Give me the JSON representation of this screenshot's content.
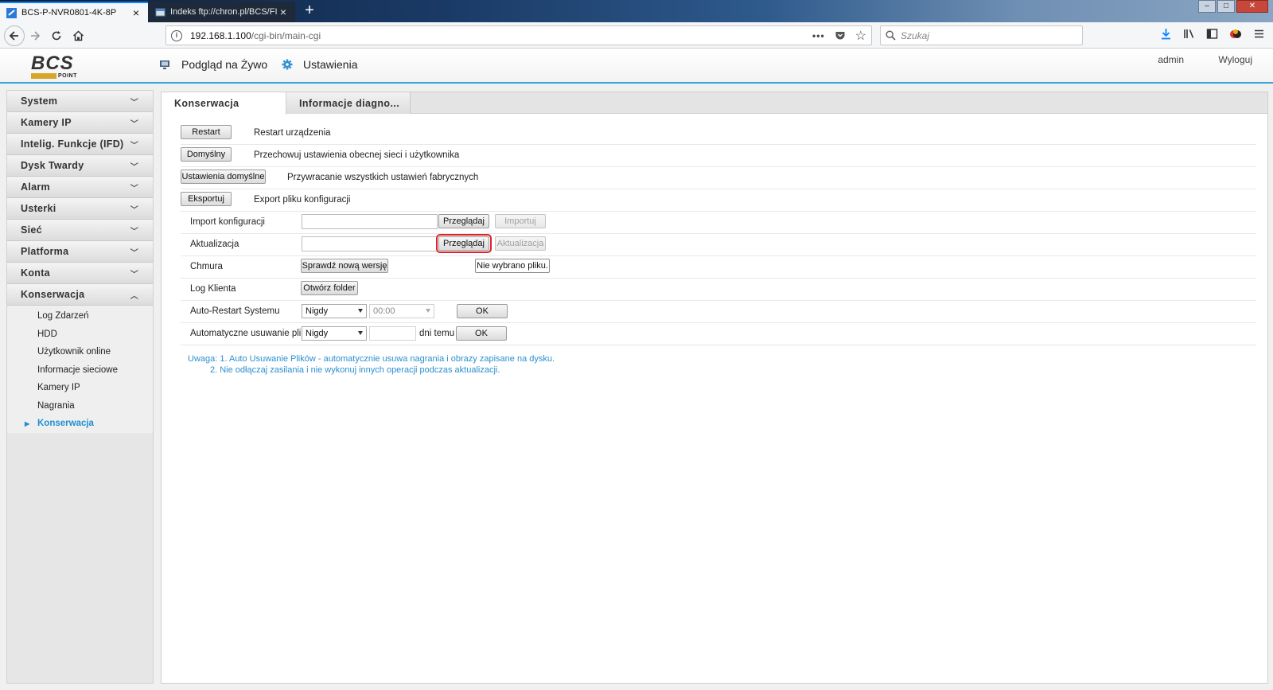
{
  "browser": {
    "tabs": [
      {
        "title": "BCS-P-NVR0801-4K-8P",
        "active": true
      },
      {
        "title": "Indeks ftp://chron.pl/BCS/FIRM",
        "active": false
      }
    ],
    "url_host": "192.168.1.100",
    "url_path": "/cgi-bin/main-cgi",
    "search_placeholder": "Szukaj"
  },
  "header": {
    "logo_text": "BCS",
    "logo_sub": "POINT",
    "nav_live": "Podgląd na Żywo",
    "nav_settings": "Ustawienia",
    "user": "admin",
    "logout": "Wyloguj"
  },
  "sidebar": {
    "items": [
      {
        "label": "System"
      },
      {
        "label": "Kamery IP"
      },
      {
        "label": "Intelig. Funkcje (IFD)"
      },
      {
        "label": "Dysk Twardy"
      },
      {
        "label": "Alarm"
      },
      {
        "label": "Usterki"
      },
      {
        "label": "Sieć"
      },
      {
        "label": "Platforma"
      },
      {
        "label": "Konta"
      },
      {
        "label": "Konserwacja"
      }
    ],
    "subitems": [
      {
        "label": "Log Zdarzeń"
      },
      {
        "label": "HDD"
      },
      {
        "label": "Użytkownik online"
      },
      {
        "label": "Informacje sieciowe"
      },
      {
        "label": "Kamery IP"
      },
      {
        "label": "Nagrania"
      },
      {
        "label": "Konserwacja"
      }
    ]
  },
  "main": {
    "tabs": [
      {
        "label": "Konserwacja"
      },
      {
        "label": "Informacje diagno..."
      }
    ],
    "restart": {
      "button": "Restart",
      "desc": "Restart urządzenia"
    },
    "default": {
      "button": "Domyślny",
      "desc": "Przechowuj ustawienia obecnej sieci i użytkownika"
    },
    "factory": {
      "button": "Ustawienia domyślne",
      "desc": "Przywracanie wszystkich ustawień fabrycznych"
    },
    "export": {
      "button": "Eksportuj",
      "desc": "Export pliku konfiguracji"
    },
    "import": {
      "label": "Import konfiguracji",
      "browse": "Przeglądaj",
      "action": "Importuj"
    },
    "update": {
      "label": "Aktualizacja",
      "browse": "Przeglądaj",
      "action": "Aktualizacja"
    },
    "cloud": {
      "label": "Chmura",
      "check": "Sprawdź nową wersję",
      "file_status": "Nie wybrano pliku."
    },
    "log": {
      "label": "Log Klienta",
      "open": "Otwórz folder"
    },
    "auto_restart": {
      "label": "Auto-Restart Systemu",
      "frequency": "Nigdy",
      "time": "00:00",
      "ok": "OK"
    },
    "auto_delete": {
      "label": "Automatyczne usuwanie pli...",
      "frequency": "Nigdy",
      "days_value": "",
      "days_suffix": "dni temu",
      "ok": "OK"
    },
    "notes": [
      "Uwaga: 1. Auto Usuwanie Plików - automatycznie usuwa nagrania i obrazy zapisane na dysku.",
      "2. Nie odłączaj zasilania i nie wykonuj innych operacji podczas aktualizacji."
    ]
  },
  "colors": {
    "accent": "#38a3d9",
    "link": "#2b8fd0",
    "highlight_border": "#e0232b"
  }
}
